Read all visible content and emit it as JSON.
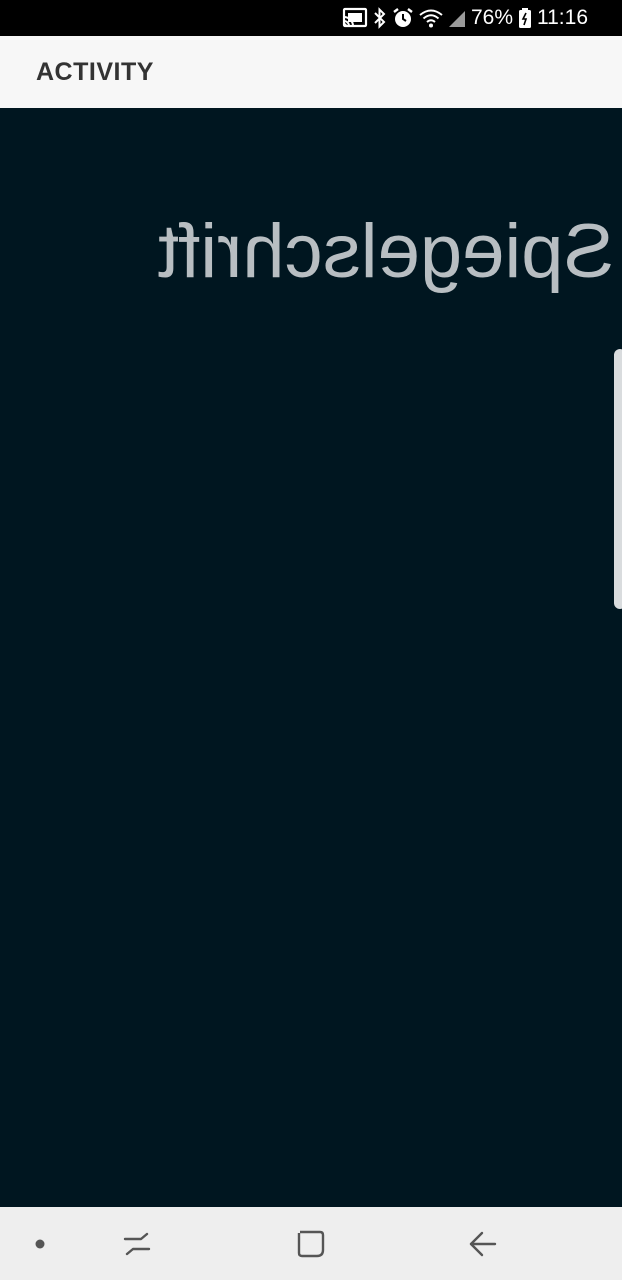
{
  "status_bar": {
    "battery_percent": "76%",
    "time": "11:16",
    "icons": [
      "cast-icon",
      "bluetooth-icon",
      "alarm-icon",
      "wifi-icon",
      "signal-icon",
      "battery-icon"
    ]
  },
  "app_bar": {
    "title": "ACTIVITY"
  },
  "content": {
    "mirrored_text": "Spiegelschrift",
    "background_color": "#001620",
    "text_color": "#b8bec2"
  },
  "nav_bar": {
    "items": [
      "dot-icon",
      "recents-icon",
      "home-icon",
      "back-icon"
    ]
  }
}
